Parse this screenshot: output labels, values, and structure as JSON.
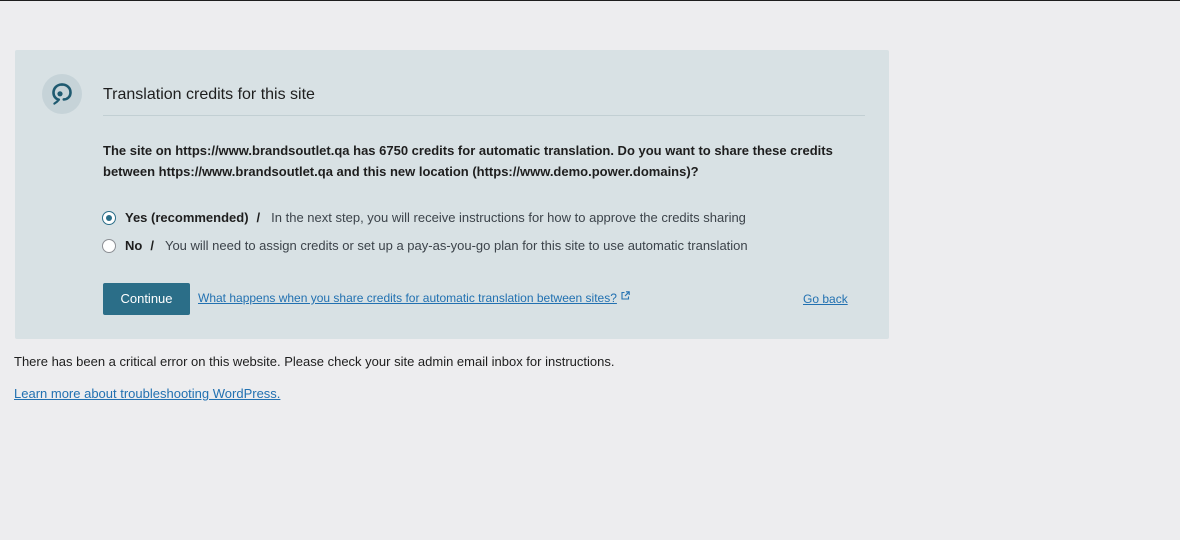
{
  "panel": {
    "logo_icon": "wpml-logo-icon",
    "title": "Translation credits for this site",
    "question": "The site on https://www.brandsoutlet.qa has 6750 credits for automatic translation. Do you want to share these credits between https://www.brandsoutlet.qa and this new location (https://www.demo.power.domains)?",
    "options": [
      {
        "label": "Yes (recommended)",
        "separator": "/",
        "description": "In the next step, you will receive instructions for how to approve the credits sharing",
        "selected": true
      },
      {
        "label": "No",
        "separator": "/",
        "description": "You will need to assign credits or set up a pay-as-you-go plan for this site to use automatic translation",
        "selected": false
      }
    ],
    "continue_label": "Continue",
    "share_link_text": "What happens when you share credits for automatic translation between sites?",
    "external_icon": "external-link-icon",
    "go_back_label": "Go back"
  },
  "error": {
    "message": "There has been a critical error on this website. Please check your site admin email inbox for instructions.",
    "link_text": "Learn more about troubleshooting WordPress."
  },
  "colors": {
    "background": "#ededef",
    "panel": "#d8e1e4",
    "accent": "#2b6e88",
    "link": "#2271b1"
  }
}
